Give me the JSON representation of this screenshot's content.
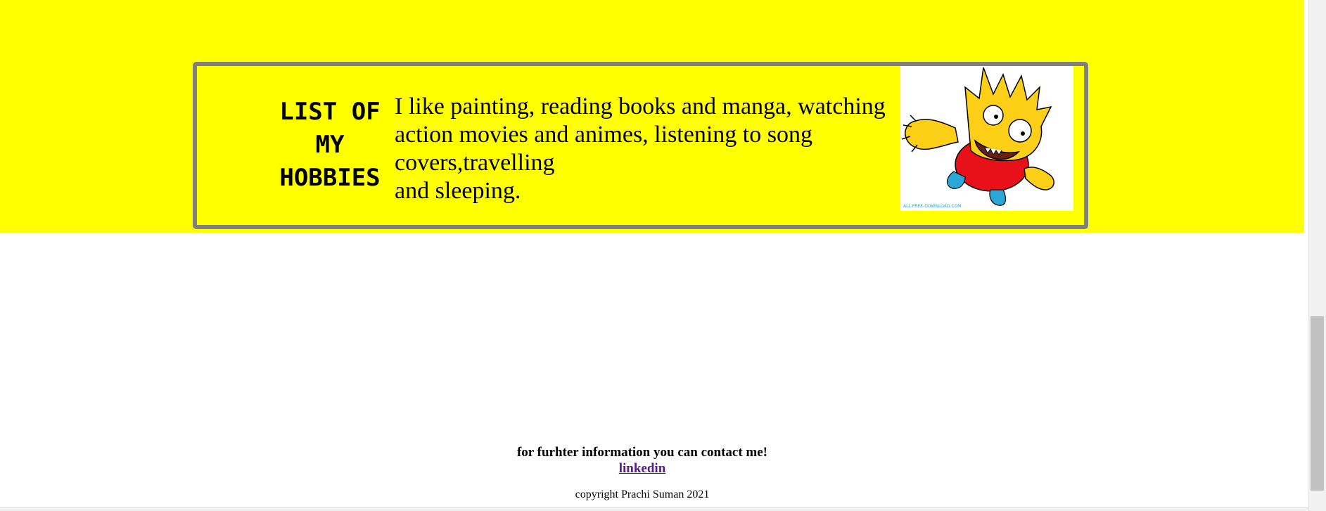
{
  "hobbies": {
    "title": "LIST OF MY HOBBIES",
    "text_lines": [
      "I like painting, reading books and manga, watching",
      "action movies and animes, listening to song",
      "covers,travelling",
      "and sleeping."
    ],
    "image_watermark": "ALL-FREE-DOWNLOAD.COM"
  },
  "footer": {
    "contact_text": "for furhter information you can contact me!",
    "link_label": "linkedin",
    "copyright": "copyright Prachi Suman 2021"
  },
  "colors": {
    "background_band": "#ffff00",
    "box_border": "#808080",
    "link_visited": "#551a8b"
  }
}
